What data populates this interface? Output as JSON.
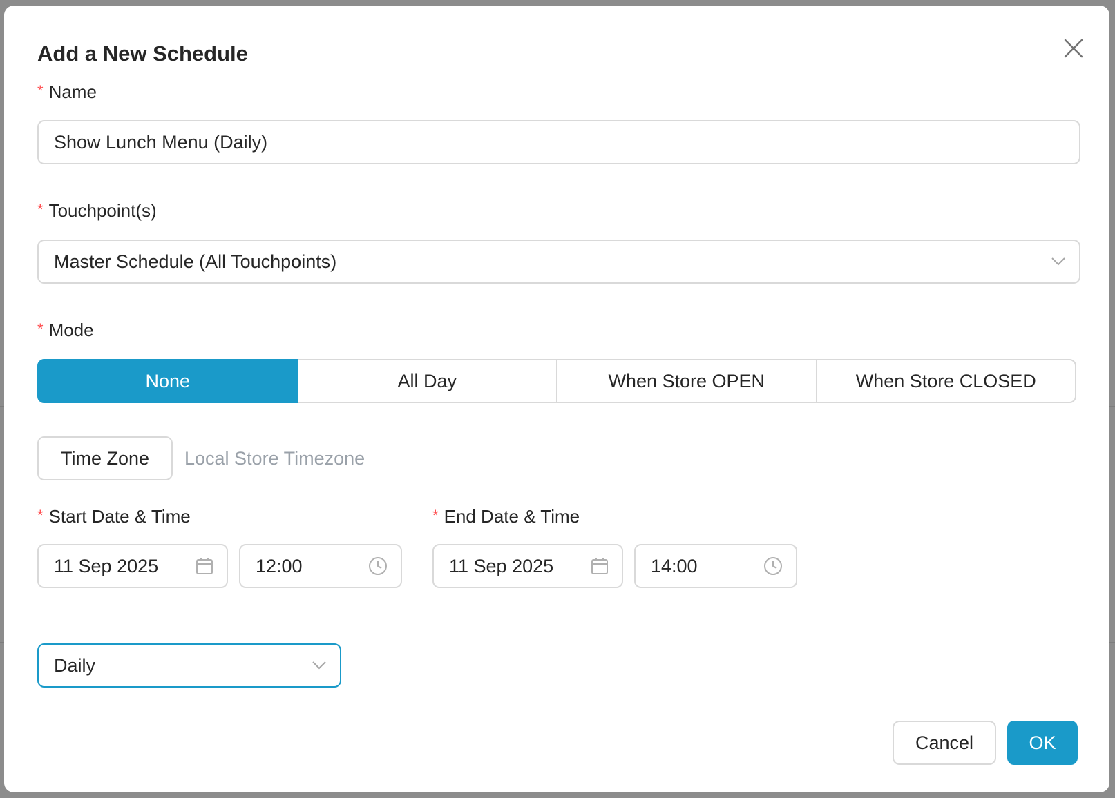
{
  "dialog": {
    "title": "Add a New Schedule",
    "close_icon": "close-icon"
  },
  "name_field": {
    "label": "Name",
    "required_mark": "*",
    "value": "Show Lunch Menu (Daily)"
  },
  "touchpoints_field": {
    "label": "Touchpoint(s)",
    "required_mark": "*",
    "value": "Master Schedule (All Touchpoints)",
    "icon": "chevron-down-icon"
  },
  "mode_field": {
    "label": "Mode",
    "required_mark": "*",
    "options": [
      "None",
      "All Day",
      "When Store OPEN",
      "When Store CLOSED"
    ],
    "selected": "None"
  },
  "timezone": {
    "button_label": "Time Zone",
    "value": "Local Store Timezone"
  },
  "start": {
    "label": "Start Date & Time",
    "required_mark": "*",
    "date": "11 Sep 2025",
    "time": "12:00",
    "date_icon": "calendar-icon",
    "time_icon": "clock-icon"
  },
  "end": {
    "label": "End Date & Time",
    "required_mark": "*",
    "date": "11 Sep 2025",
    "time": "14:00",
    "date_icon": "calendar-icon",
    "time_icon": "clock-icon"
  },
  "recurrence": {
    "value": "Daily",
    "icon": "chevron-down-icon"
  },
  "footer": {
    "cancel_label": "Cancel",
    "ok_label": "OK"
  },
  "colors": {
    "accent": "#1a9ac9",
    "required": "#ff4d4f",
    "border": "#d9d9d9",
    "muted_text": "#9aa1a9"
  }
}
